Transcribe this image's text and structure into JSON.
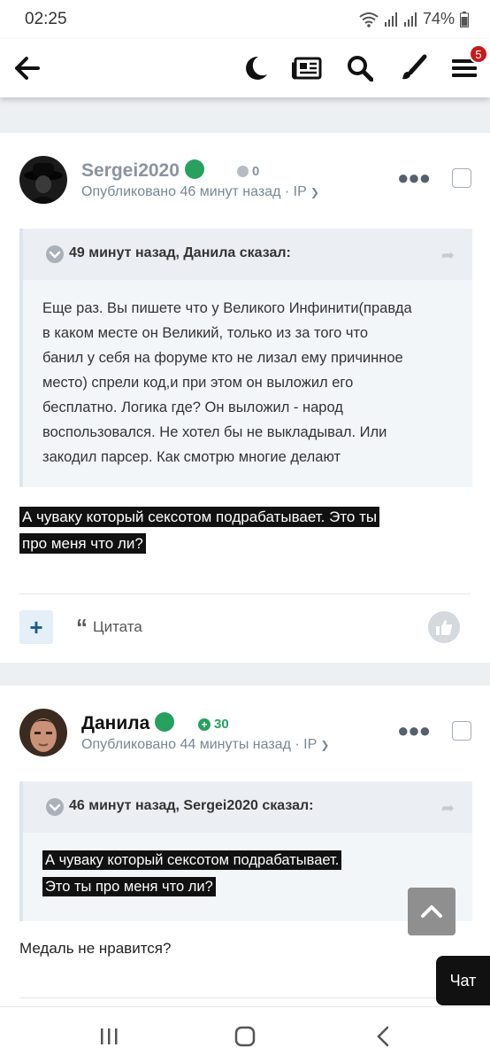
{
  "status_bar": {
    "time": "02:25",
    "battery": "74%"
  },
  "toolbar": {
    "notification_count": "5"
  },
  "posts": [
    {
      "author": "Sergei2020",
      "reputation": "0",
      "meta": "Опубликовано 46 минут назад · IP",
      "quote": {
        "header": "49 минут назад, Данила сказал:",
        "lines": [
          "Еще раз. Вы пишете что у Великого Инфинити(правда",
          "в каком месте он Великий, только из за того что",
          "банил у себя на форуме кто не лизал ему причинное",
          "место) спрели код,и при этом он выложил его",
          "бесплатно. Логика где? Он выложил - народ",
          "воспользовался. Не хотел бы не выкладывал. Или",
          "закодил парсер. Как смотрю многие делают"
        ]
      },
      "text_lines": [
        "А чуваку который сексотом подрабатывает. Это ты",
        "про меня что ли?"
      ],
      "actions": {
        "plus": "+",
        "quote_label": "Цитата"
      }
    },
    {
      "author": "Данила",
      "reputation": "30",
      "meta": "Опубликовано 44 минуты назад · IP",
      "quote": {
        "header": "46 минут назад, Sergei2020 сказал:",
        "lines": [
          "А чуваку который сексотом подрабатывает.",
          "Это ты про меня что ли?"
        ]
      },
      "text": "Медаль не нравится?"
    }
  ],
  "chat_label": "Чат",
  "colors": {
    "online": "#27a060",
    "badge": "#c61b1b",
    "reputation_positive": "#27a060"
  }
}
